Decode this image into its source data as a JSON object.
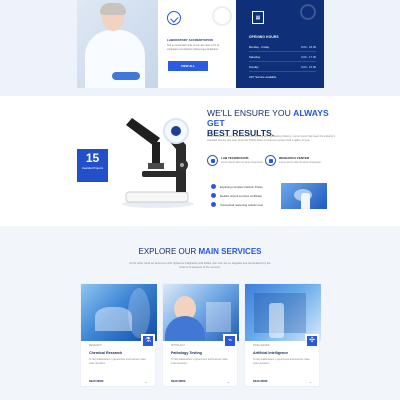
{
  "hero": {
    "accreditation_title": "LABORATORY ACCREDITATION",
    "accreditation_text": "Sed ut perspiciatis unde omnis iste natus error sit voluptatem accusantium doloremque laudantium.",
    "view_all": "VIEW ALL"
  },
  "hours": {
    "title": "OPENING HOURS",
    "rows": [
      {
        "day": "Monday - Friday",
        "time": "8.00 - 18.00"
      },
      {
        "day": "Saturday",
        "time": "9.00 - 17.00"
      },
      {
        "day": "Sunday",
        "time": "9.00 - 15.00"
      },
      {
        "day": "24/7 Service available",
        "time": ""
      }
    ]
  },
  "ensure": {
    "heading_normal": "WE'LL ENSURE YOU",
    "heading_strong": "ALWAYS GET",
    "heading_dark": "BEST RESULTS.",
    "text": "Lorem ipsum is simply dummy text of the printing and typesetting industry. Lorem ipsum has been the industry's standard dummy text ever since the 1500s when an unknown printer took a galley of type.",
    "badge_number": "15",
    "badge_label": "Awarded Projects",
    "features": [
      {
        "title": "LAB TECHNICIANS",
        "text": "Lorem ipsum dolor sit amet consectetur."
      },
      {
        "title": "RESEARCH CENTER",
        "text": "Lorem ipsum dolor sit amet consectetur."
      }
    ],
    "checks": [
      "Exploring complex infection Points",
      "Realize stimuli services certificate",
      "Conceptual reasoning solution test"
    ]
  },
  "services": {
    "heading_normal": "EXPLORE OUR",
    "heading_strong": "MAIN SERVICES",
    "subtitle": "At the other hand we denounce with righteous indignation and dislike men who are so beguiled and demoralized by the charms of pleasure of the moment.",
    "cards": [
      {
        "category": "RESEARCH",
        "title": "Chemical Research",
        "text": "To help stakeholders in government and business make smart decisions.",
        "read_more": "READ MORE",
        "icon": "flask-icon"
      },
      {
        "category": "PATHOLOGY",
        "title": "Pathology Testing",
        "text": "To help stakeholders in government and business make smart decisions.",
        "read_more": "READ MORE",
        "icon": "microscope-icon"
      },
      {
        "category": "INTELLIGENCE",
        "title": "Artificial Intelligence",
        "text": "To help stakeholders in government and business make smart decisions.",
        "read_more": "READ MORE",
        "icon": "lab-icon"
      }
    ]
  }
}
